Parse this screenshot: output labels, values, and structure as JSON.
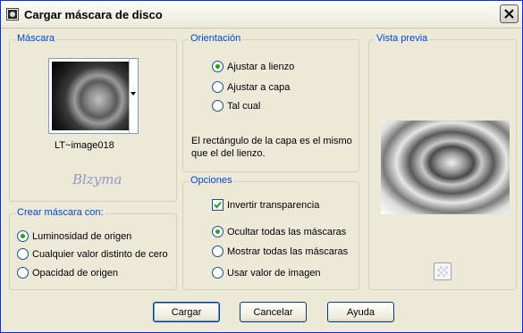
{
  "window": {
    "title": "Cargar máscara de disco"
  },
  "mascara": {
    "legend": "Máscara",
    "mask_name": "LT~image018",
    "watermark": "Blzyma"
  },
  "crear": {
    "legend": "Crear máscara con:",
    "options": [
      {
        "label": "Luminosidad de origen",
        "checked": true
      },
      {
        "label": "Cualquier valor distinto de cero",
        "checked": false
      },
      {
        "label": "Opacidad de origen",
        "checked": false
      }
    ]
  },
  "orientacion": {
    "legend": "Orientación",
    "options": [
      {
        "label": "Ajustar a lienzo",
        "checked": true
      },
      {
        "label": "Ajustar a capa",
        "checked": false
      },
      {
        "label": "Tal cual",
        "checked": false
      }
    ],
    "description": "El rectángulo de la capa es el mismo que el del lienzo."
  },
  "opciones": {
    "legend": "Opciones",
    "invert_label": "Invertir transparencia",
    "invert_checked": true,
    "options": [
      {
        "label": "Ocultar todas las máscaras",
        "checked": true
      },
      {
        "label": "Mostrar todas las máscaras",
        "checked": false
      },
      {
        "label": "Usar valor de imagen",
        "checked": false
      }
    ]
  },
  "vista": {
    "legend": "Vista previa"
  },
  "buttons": {
    "load": "Cargar",
    "cancel": "Cancelar",
    "help": "Ayuda"
  },
  "icons": {
    "title_icon": "mask-document-icon",
    "close": "close-icon",
    "dropdown": "chevron-down-icon",
    "preview_tool": "checkerboard-icon"
  }
}
